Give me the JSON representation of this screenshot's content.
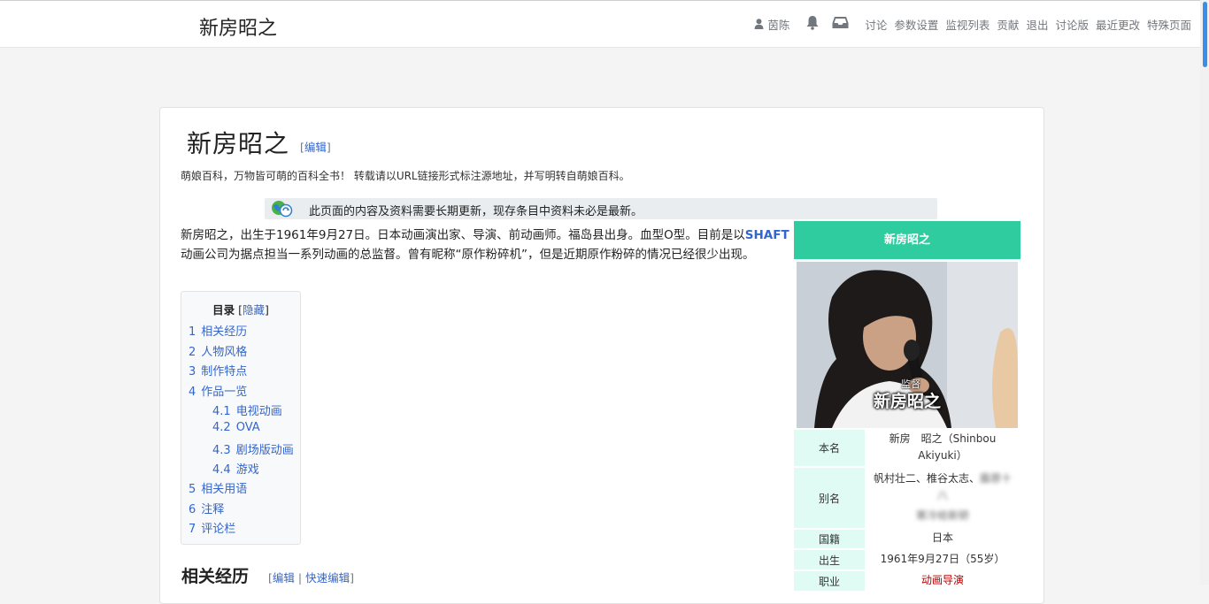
{
  "site": {
    "title": "新房昭之",
    "user": "茵陈",
    "nav": [
      "讨论",
      "参数设置",
      "监视列表",
      "贡献",
      "退出",
      "讨论版",
      "最近更改",
      "特殊页面"
    ]
  },
  "article": {
    "title": "新房昭之",
    "edit_label": "编辑",
    "edit_open": "[",
    "edit_close": "]",
    "tagline": "萌娘百科，万物皆可萌的百科全书！ 转载请以URL链接形式标注源地址，并写明转自萌娘百科。",
    "notice": "此页面的内容及资料需要长期更新，现存条目中资料未必是最新。",
    "intro_part1": "新房昭之，出生于1961年9月27日。日本动画演出家、导演、前动画师。福岛县出身。血型O型。目前是以",
    "intro_shaft": "SHAFT",
    "intro_part2": "动画公司为据点担当一系列动画的总监督。曾有昵称“原作粉碎机”，但是近期原作粉碎的情况已经很少出现。"
  },
  "toc": {
    "title": "目录",
    "hide": "隐藏",
    "items": [
      {
        "num": "1",
        "label": "相关经历",
        "level": 1
      },
      {
        "num": "2",
        "label": "人物风格",
        "level": 1
      },
      {
        "num": "3",
        "label": "制作特点",
        "level": 1
      },
      {
        "num": "4",
        "label": "作品一览",
        "level": 1
      },
      {
        "num": "4.1",
        "label": "电视动画",
        "level": 2
      },
      {
        "num": "4.2",
        "label": "OVA",
        "level": 2
      },
      {
        "num": "4.3",
        "label": "剧场版动画",
        "level": 2
      },
      {
        "num": "4.4",
        "label": "游戏",
        "level": 2
      },
      {
        "num": "5",
        "label": "相关用语",
        "level": 1
      },
      {
        "num": "6",
        "label": "注释",
        "level": 1
      },
      {
        "num": "7",
        "label": "评论栏",
        "level": 1
      }
    ]
  },
  "section": {
    "heading": "相关经历",
    "edit": "编辑",
    "quick_edit": "快速编辑",
    "sep": "|"
  },
  "infobox": {
    "header": "新房昭之",
    "image_caption_small": "监督",
    "image_caption_big": "新房昭之",
    "rows": {
      "name_label": "本名",
      "name_value": "新房　昭之（Shinbou Akiyuki）",
      "alias_label": "别名",
      "alias_value": "帆村壮二、椎谷太志、",
      "alias_blur1": "藤原十八",
      "alias_blur2": "寒冷给新轿",
      "nation_label": "国籍",
      "nation_value": "日本",
      "birth_label": "出生",
      "birth_value": "1961年9月27日（55岁）",
      "job_label": "职业",
      "job_value": "动画导演"
    }
  },
  "colors": {
    "accent": "#2ecc9e",
    "link": "#3366cc",
    "infobox_label_bg": "#e0faf4"
  }
}
